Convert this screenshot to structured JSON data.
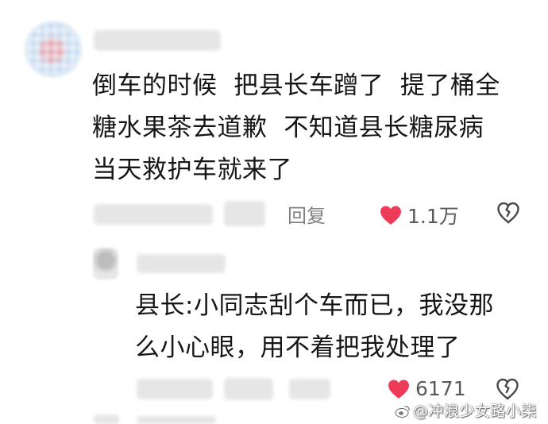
{
  "comment": {
    "lines": [
      "倒车的时候  把县长车蹭了  提了桶全",
      "糖水果茶去道歉  不知道县长糖尿病",
      "当天救护车就来了"
    ],
    "reply_label": "回复",
    "like_count": "1.1万",
    "like_color": "#ef3b5a"
  },
  "reply": {
    "lines": [
      "县长:小同志刮个车而已，我没那",
      "么小心眼，用不着把我处理了"
    ],
    "like_count": "6171",
    "like_color": "#ef3b5a"
  },
  "watermark": {
    "text": "@冲浪少女路小柒"
  },
  "icons": {
    "like": "heart-icon",
    "dislike": "broken-heart-icon",
    "watermark": "weibo-icon"
  }
}
